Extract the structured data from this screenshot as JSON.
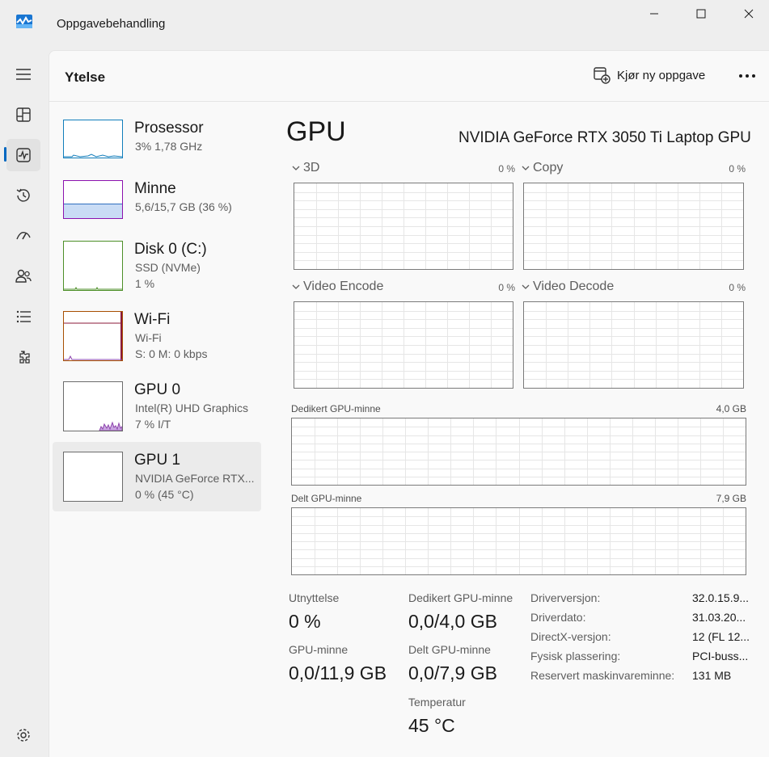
{
  "window": {
    "title": "Oppgavebehandling"
  },
  "header": {
    "page_title": "Ytelse",
    "run_new_task": "Kjør ny oppgave",
    "more_icon": "more-horizontal-icon"
  },
  "nav": {
    "items": [
      {
        "icon": "hamburger-menu-icon"
      },
      {
        "icon": "processes-icon"
      },
      {
        "icon": "performance-icon",
        "active": true
      },
      {
        "icon": "app-history-icon"
      },
      {
        "icon": "startup-apps-icon"
      },
      {
        "icon": "users-icon"
      },
      {
        "icon": "details-icon"
      },
      {
        "icon": "services-icon"
      },
      {
        "icon": "settings-icon"
      }
    ]
  },
  "sidebar": {
    "items": [
      {
        "name": "Prosessor",
        "line1": "3%  1,78 GHz",
        "line2": ""
      },
      {
        "name": "Minne",
        "line1": "5,6/15,7 GB (36 %)",
        "line2": ""
      },
      {
        "name": "Disk 0 (C:)",
        "line1": "SSD (NVMe)",
        "line2": "1 %"
      },
      {
        "name": "Wi-Fi",
        "line1": "Wi-Fi",
        "line2": "S: 0  M: 0 kbps"
      },
      {
        "name": "GPU 0",
        "line1": "Intel(R) UHD Graphics",
        "line2": "7 % I/T"
      },
      {
        "name": "GPU 1",
        "line1": "NVIDIA GeForce RTX...",
        "line2": "0 % (45 °C)"
      }
    ],
    "memory_fill_fraction": 0.36
  },
  "gpu": {
    "title": "GPU",
    "model": "NVIDIA GeForce RTX 3050 Ti Laptop GPU",
    "engines": [
      {
        "label": "3D",
        "pct": "0 %"
      },
      {
        "label": "Copy",
        "pct": "0 %"
      },
      {
        "label": "Video Encode",
        "pct": "0 %"
      },
      {
        "label": "Video Decode",
        "pct": "0 %"
      }
    ],
    "dedicated_mem": {
      "label": "Dedikert GPU-minne",
      "max": "4,0 GB"
    },
    "shared_mem": {
      "label": "Delt GPU-minne",
      "max": "7,9 GB"
    }
  },
  "stats": {
    "utilization": {
      "label": "Utnyttelse",
      "value": "0 %"
    },
    "dedicated": {
      "label": "Dedikert GPU-minne",
      "value": "0,0/4,0 GB"
    },
    "gpu_memory": {
      "label": "GPU-minne",
      "value": "0,0/11,9 GB"
    },
    "shared": {
      "label": "Delt GPU-minne",
      "value": "0,0/7,9 GB"
    },
    "temperature": {
      "label": "Temperatur",
      "value": "45 °C"
    }
  },
  "info": [
    {
      "label": "Driverversjon:",
      "value": "32.0.15.9..."
    },
    {
      "label": "Driverdato:",
      "value": "31.03.20..."
    },
    {
      "label": "DirectX-versjon:",
      "value": "12 (FL 12..."
    },
    {
      "label": "Fysisk plassering:",
      "value": "PCI-buss..."
    },
    {
      "label": "Reservert maskinvareminne:",
      "value": "131 MB"
    }
  ],
  "colors": {
    "accent": "#0067c0",
    "cpu_line": "#117dbb",
    "memory_fill": "#c9dcf5",
    "memory_line": "#8b12ae",
    "wifi_line": "#a74f01",
    "gpu_line": "#8e44ad",
    "grid": "#e6e6e6"
  }
}
